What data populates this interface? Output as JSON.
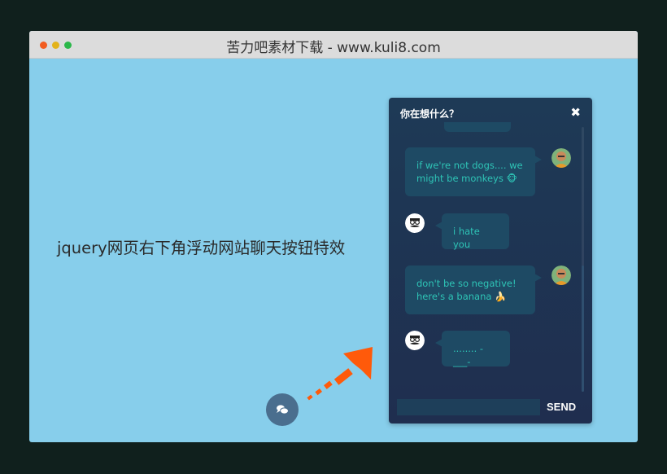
{
  "window": {
    "title": "苦力吧素材下载 - www.kuli8.com"
  },
  "page": {
    "heading": "jquery网页右下角浮动网站聊天按钮特效"
  },
  "chat": {
    "title": "你在想什么？",
    "close_icon": "✖",
    "messages": [
      {
        "side": "right",
        "lines": [
          "if we're not dogs.... we",
          "might be monkeys 🐵"
        ]
      },
      {
        "side": "left",
        "lines": [
          "i hate you"
        ]
      },
      {
        "side": "right",
        "lines": [
          "don't be so negative!",
          "here's a banana 🍌"
        ]
      },
      {
        "side": "left",
        "lines": [
          "........ -___-"
        ]
      }
    ],
    "input": {
      "value": "",
      "placeholder": ""
    },
    "send_label": "SEND"
  },
  "colors": {
    "window_dots": [
      "#f25c20",
      "#e3b31b",
      "#2bb84a"
    ],
    "accent_text": "#2ec4b6",
    "arrow": "#ff5a0a"
  },
  "icons": {
    "close": "close-icon",
    "chat_button": "chat-bubble-icon",
    "user_avatar": "bald-man-avatar-icon",
    "bot_avatar": "mustache-man-avatar-icon",
    "pointer": "orange-arrow-icon"
  }
}
